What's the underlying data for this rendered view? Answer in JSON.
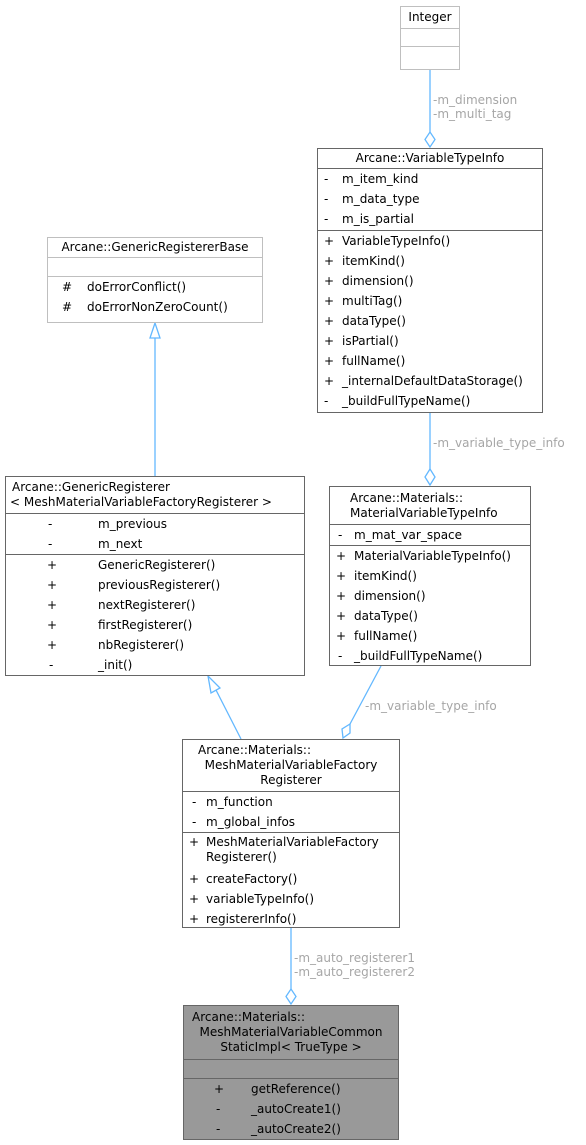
{
  "classes": {
    "integer": {
      "title": [
        "Integer"
      ],
      "attributes": [],
      "methods": []
    },
    "variable_type_info": {
      "title": [
        "Arcane::VariableTypeInfo"
      ],
      "attributes": [
        {
          "vis": "-",
          "name": "m_item_kind"
        },
        {
          "vis": "-",
          "name": "m_data_type"
        },
        {
          "vis": "-",
          "name": "m_is_partial"
        }
      ],
      "methods": [
        {
          "vis": "+",
          "name": "VariableTypeInfo()"
        },
        {
          "vis": "+",
          "name": "itemKind()"
        },
        {
          "vis": "+",
          "name": "dimension()"
        },
        {
          "vis": "+",
          "name": "multiTag()"
        },
        {
          "vis": "+",
          "name": "dataType()"
        },
        {
          "vis": "+",
          "name": "isPartial()"
        },
        {
          "vis": "+",
          "name": "fullName()"
        },
        {
          "vis": "+",
          "name": "_internalDefaultDataStorage()"
        },
        {
          "vis": "-",
          "name": "_buildFullTypeName()"
        }
      ]
    },
    "generic_registerer_base": {
      "title": [
        "Arcane::GenericRegistererBase"
      ],
      "attributes": [],
      "methods": [
        {
          "vis": "#",
          "name": "doErrorConflict()"
        },
        {
          "vis": "#",
          "name": "doErrorNonZeroCount()"
        }
      ]
    },
    "generic_registerer": {
      "title": [
        "Arcane::GenericRegisterer",
        "< MeshMaterialVariableFactoryRegisterer >"
      ],
      "attributes": [
        {
          "vis": "-",
          "name": "m_previous"
        },
        {
          "vis": "-",
          "name": "m_next"
        }
      ],
      "methods": [
        {
          "vis": "+",
          "name": "GenericRegisterer()"
        },
        {
          "vis": "+",
          "name": "previousRegisterer()"
        },
        {
          "vis": "+",
          "name": "nextRegisterer()"
        },
        {
          "vis": "+",
          "name": "firstRegisterer()"
        },
        {
          "vis": "+",
          "name": "nbRegisterer()"
        },
        {
          "vis": "-",
          "name": "_init()"
        }
      ]
    },
    "material_variable_type_info": {
      "title": [
        "Arcane::Materials::",
        "MaterialVariableTypeInfo"
      ],
      "attributes": [
        {
          "vis": "-",
          "name": "m_mat_var_space"
        }
      ],
      "methods": [
        {
          "vis": "+",
          "name": "MaterialVariableTypeInfo()"
        },
        {
          "vis": "+",
          "name": "itemKind()"
        },
        {
          "vis": "+",
          "name": "dimension()"
        },
        {
          "vis": "+",
          "name": "dataType()"
        },
        {
          "vis": "+",
          "name": "fullName()"
        },
        {
          "vis": "-",
          "name": "_buildFullTypeName()"
        }
      ]
    },
    "factory_registerer": {
      "title": [
        "Arcane::Materials::",
        "MeshMaterialVariableFactory",
        "Registerer"
      ],
      "attributes": [
        {
          "vis": "-",
          "name": "m_function"
        },
        {
          "vis": "-",
          "name": "m_global_infos"
        }
      ],
      "methods": [
        {
          "vis": "+",
          "name": "MeshMaterialVariableFactory",
          "name2": "Registerer()"
        },
        {
          "vis": "+",
          "name": "createFactory()"
        },
        {
          "vis": "+",
          "name": "variableTypeInfo()"
        },
        {
          "vis": "+",
          "name": "registererInfo()"
        }
      ]
    },
    "common_static_impl": {
      "title": [
        "Arcane::Materials::",
        "MeshMaterialVariableCommon",
        "StaticImpl< TrueType >"
      ],
      "attributes": [],
      "methods": [
        {
          "vis": "+",
          "name": "getReference()"
        },
        {
          "vis": "-",
          "name": "_autoCreate1()"
        },
        {
          "vis": "-",
          "name": "_autoCreate2()"
        }
      ]
    }
  },
  "edge_labels": {
    "integer_to_vti": [
      "-m_dimension",
      "-m_multi_tag"
    ],
    "vti_to_mvti": [
      "-m_variable_type_info"
    ],
    "mvti_to_factory": [
      "-m_variable_type_info"
    ],
    "factory_to_impl": [
      "-m_auto_registerer1",
      "-m_auto_registerer2"
    ]
  },
  "colors": {
    "edge": "#63b8ff",
    "label": "#a6a6a6",
    "border": "#666666",
    "light_border": "#bfbfbf",
    "focus_fill": "#999999"
  }
}
